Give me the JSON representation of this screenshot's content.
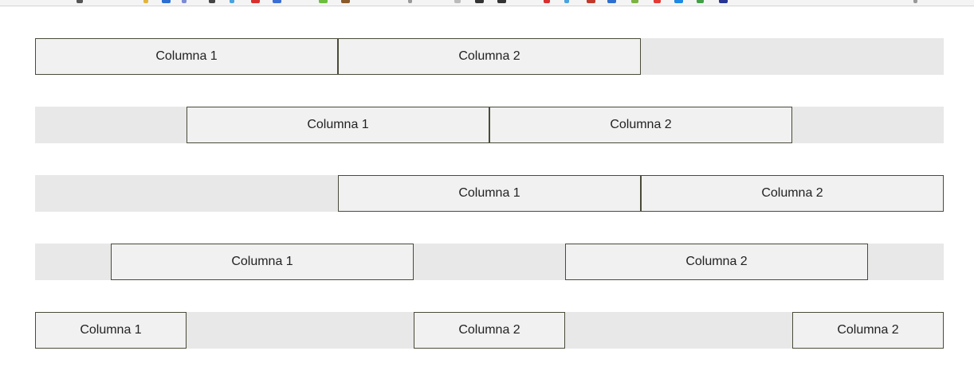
{
  "rows": [
    {
      "cells": [
        "Columna 1",
        "Columna 2"
      ]
    },
    {
      "cells": [
        "Columna 1",
        "Columna 2"
      ]
    },
    {
      "cells": [
        "Columna 1",
        "Columna 2"
      ]
    },
    {
      "cells": [
        "Columna 1",
        "Columna 2"
      ]
    },
    {
      "cells": [
        "Columna 1",
        "Columna 2",
        "Columna 2"
      ]
    }
  ],
  "colors": {
    "row_background": "#e8e8e8",
    "column_background": "#f1f1f1",
    "column_border": "#4a4a3a",
    "text": "#222222"
  }
}
